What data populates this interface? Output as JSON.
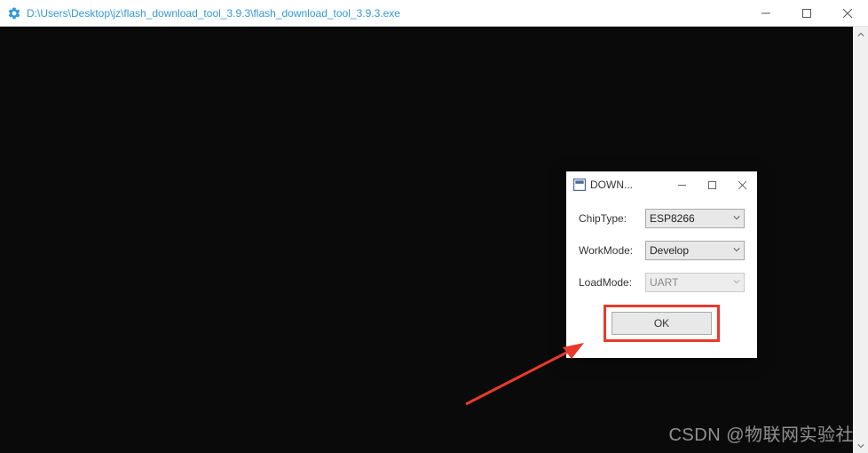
{
  "main": {
    "title": "D:\\Users\\Desktop\\jz\\flash_download_tool_3.9.3\\flash_download_tool_3.9.3.exe"
  },
  "dialog": {
    "title": "DOWN...",
    "chipTypeLabel": "ChipType:",
    "chipTypeValue": "ESP8266",
    "workModeLabel": "WorkMode:",
    "workModeValue": "Develop",
    "loadModeLabel": "LoadMode:",
    "loadModeValue": "UART",
    "okLabel": "OK"
  },
  "watermark": "CSDN @物联网实验社",
  "colors": {
    "highlight": "#e83a2a",
    "titleColor": "#3498db"
  }
}
